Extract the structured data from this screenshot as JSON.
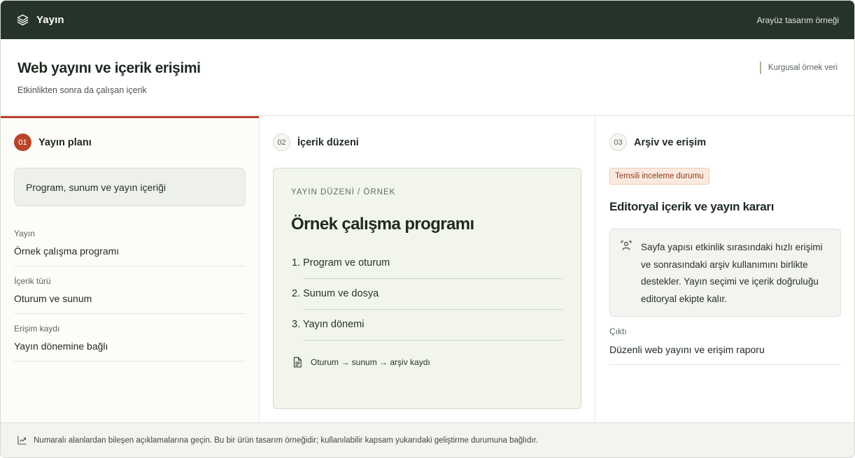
{
  "topbar": {
    "brand": "Yayın",
    "brand_icon": "layers-icon",
    "right_text": "Arayüz tasarım örneği"
  },
  "header": {
    "title": "Web yayını ve içerik erişimi",
    "subtitle": "Etkinlikten sonra da çalışan içerik",
    "badge": "Kurgusal örnek veri"
  },
  "col1": {
    "step": "01",
    "title": "Yayın planı",
    "intro": "Program, sunum ve yayın içeriği",
    "fields": [
      {
        "label": "Yayın",
        "value": "Örnek çalışma programı"
      },
      {
        "label": "İçerik türü",
        "value": "Oturum ve sunum"
      },
      {
        "label": "Erişim kaydı",
        "value": "Yayın dönemine bağlı"
      }
    ]
  },
  "col2": {
    "step": "02",
    "title": "İçerik düzeni",
    "preview": {
      "kicker": "YAYIN DÜZENİ / ÖRNEK",
      "title": "Örnek çalışma programı",
      "items": [
        "1. Program ve oturum",
        "2. Sunum ve dosya",
        "3. Yayın dönemi"
      ],
      "flow": "Oturum → sunum → arşiv kaydı",
      "flow_icon": "document-icon"
    }
  },
  "col3": {
    "step": "03",
    "title": "Arşiv ve erişim",
    "status": "Temsili inceleme durumu",
    "decision_title": "Editoryal içerik ve yayın kararı",
    "note": "Sayfa yapısı etkinlik sırasındaki hızlı erişimi ve sonrasındaki arşiv kullanımını birlikte destekler. Yayın seçimi ve içerik doğruluğu editoryal ekipte kalır.",
    "note_icon": "person-icon",
    "output_label": "Çıktı",
    "output_value": "Düzenli web yayını ve erişim raporu"
  },
  "footer": {
    "text": "Numaralı alanlardan bileşen açıklamalarına geçin. Bu bir ürün tasarım örneğidir; kullanılabilir kapsam yukarıdaki geliştirme durumuna bağlıdır.",
    "icon": "trend-chart-icon"
  },
  "colors": {
    "topbar": "#263328",
    "accent": "#b8452a",
    "preview_bg": "#f2f6ea",
    "status_bg": "#fbe9df"
  }
}
